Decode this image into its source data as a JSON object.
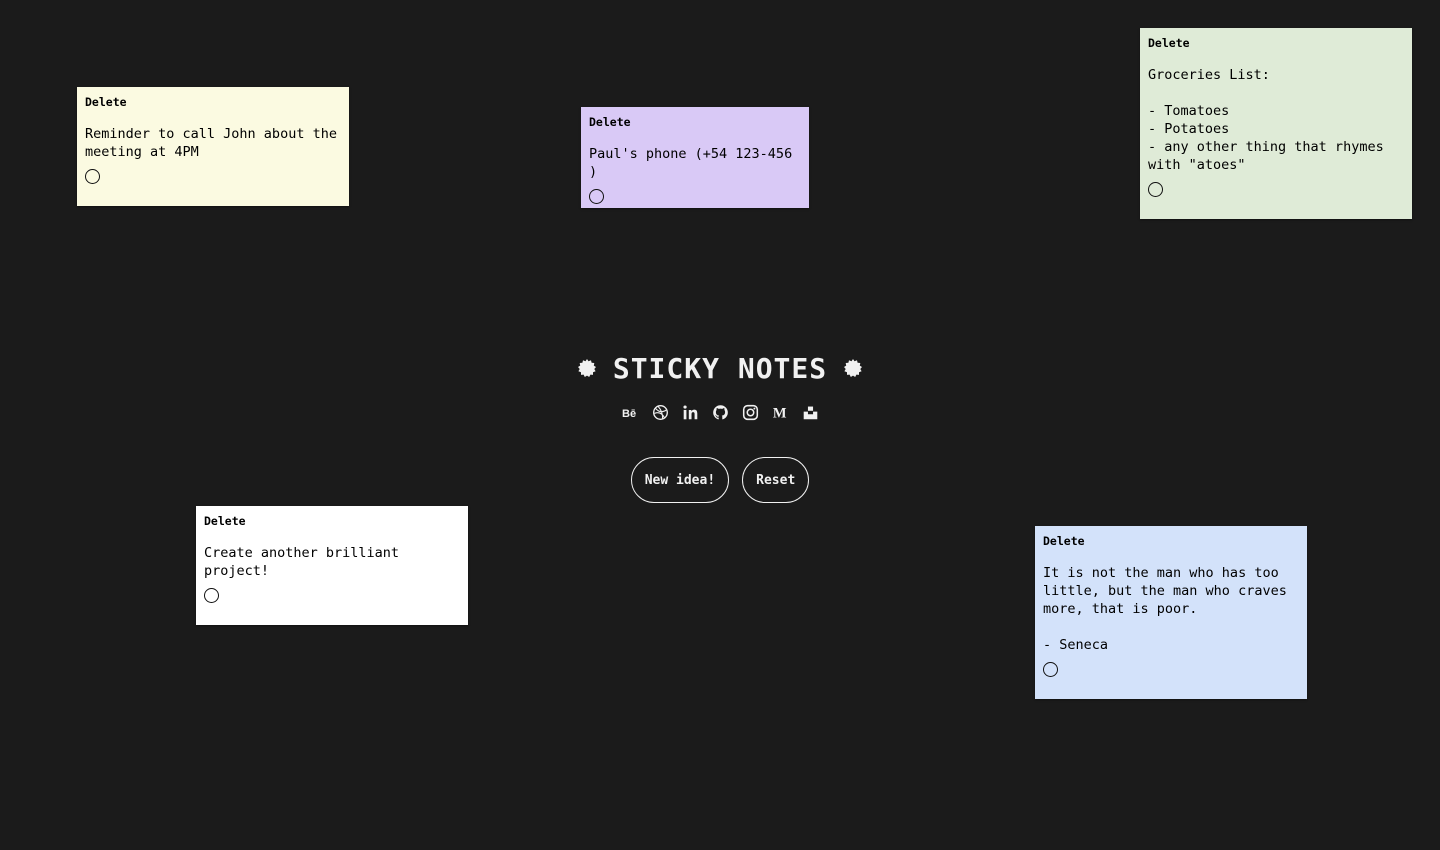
{
  "app": {
    "title": "STICKY NOTES"
  },
  "colors": {
    "background": "#1b1b1b",
    "note_yellow": "#fbfae1",
    "note_purple": "#d9c9f6",
    "note_green": "#dfebd7",
    "note_white": "#ffffff",
    "note_blue": "#d3e2fa"
  },
  "social": [
    {
      "icon": "behance-icon"
    },
    {
      "icon": "dribbble-icon"
    },
    {
      "icon": "linkedin-icon"
    },
    {
      "icon": "github-icon"
    },
    {
      "icon": "instagram-icon"
    },
    {
      "icon": "medium-icon"
    },
    {
      "icon": "unsplash-icon"
    }
  ],
  "buttons": {
    "new_idea": "New idea!",
    "reset": "Reset"
  },
  "notes": [
    {
      "delete_label": "Delete",
      "text": "Reminder to call John about the\nmeeting at 4PM",
      "color": "#fbfae1"
    },
    {
      "delete_label": "Delete",
      "text": "Paul's phone (+54 123-456 )",
      "color": "#d9c9f6"
    },
    {
      "delete_label": "Delete",
      "text": "Groceries List:\n\n- Tomatoes\n- Potatoes\n- any other thing that rhymes\nwith \"atoes\"",
      "color": "#dfebd7"
    },
    {
      "delete_label": "Delete",
      "text": "Create another brilliant\nproject!",
      "color": "#ffffff"
    },
    {
      "delete_label": "Delete",
      "text": "It is not the man who has too\nlittle, but the man who craves\nmore, that is poor.\n\n- Seneca",
      "color": "#d3e2fa"
    }
  ]
}
